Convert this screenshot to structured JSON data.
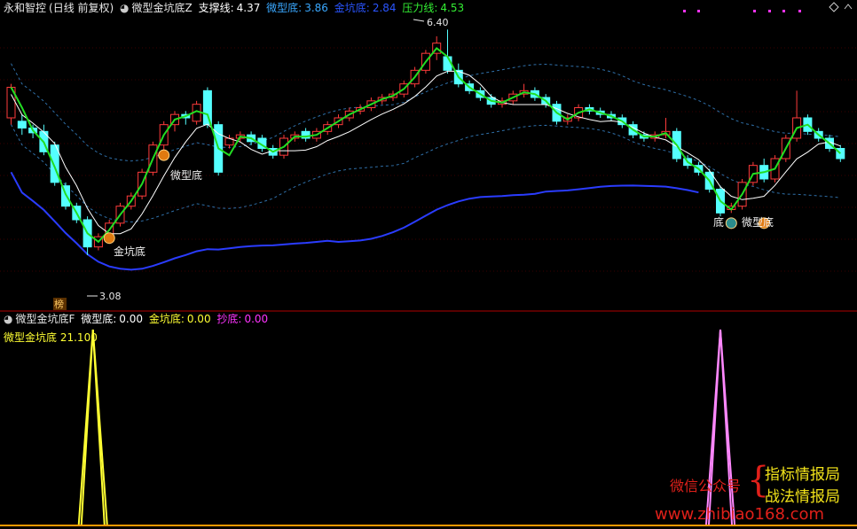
{
  "header": {
    "stock": "永和智控",
    "period": "(日线 前复权)",
    "indicator": "微型金坑底Z",
    "support_label": "支撑线:",
    "support_value": "4.37",
    "micro_label": "微型底:",
    "micro_value": "3.86",
    "pit_label": "金坑底:",
    "pit_value": "2.84",
    "pressure_label": "压力线:",
    "pressure_value": "4.53"
  },
  "lower_header": {
    "indicator": "微型金坑底F",
    "micro_label": "微型底:",
    "micro_value": "0.00",
    "pit_label": "金坑底:",
    "pit_value": "0.00",
    "bottom_label": "抄底:",
    "bottom_value": "0.00"
  },
  "lower_sub": {
    "label": "微型金坑底",
    "value": "21.100"
  },
  "annotations": {
    "high": "6.40",
    "low": "3.08",
    "micro1": "微型底",
    "pit1": "金坑底",
    "micro2": "微型底",
    "di": "底",
    "bang": "榜"
  },
  "watermark": {
    "line1": "微信公众号",
    "line2": "指标情报局",
    "line3": "战法情报局",
    "url": "www.zhibiao168.com",
    "brace": "{"
  },
  "colors": {
    "up": "#ff3b3b",
    "down": "#54ffff",
    "green_line": "#22dd22",
    "white_line": "#ffffff",
    "blue_line": "#2a3cff",
    "dash_line": "#2f6fa8",
    "yellow": "#ffff33",
    "magenta": "#ff33ff",
    "pink": "#ff88ff",
    "divider": "#b00000"
  },
  "chart_data": {
    "type": "candlestick",
    "y_range": [
      2.4,
      6.6
    ],
    "bars": [
      [
        5.1,
        5.55,
        5.0,
        5.6
      ],
      [
        5.05,
        4.95,
        4.85,
        5.15
      ],
      [
        4.95,
        4.88,
        4.8,
        5.0
      ],
      [
        4.9,
        4.6,
        4.55,
        5.0
      ],
      [
        4.7,
        4.15,
        4.1,
        4.75
      ],
      [
        4.1,
        3.8,
        3.75,
        4.15
      ],
      [
        3.8,
        3.6,
        3.55,
        3.85
      ],
      [
        3.6,
        3.2,
        3.08,
        3.65
      ],
      [
        3.2,
        3.35,
        3.15,
        3.4
      ],
      [
        3.35,
        3.55,
        3.3,
        3.6
      ],
      [
        3.55,
        3.8,
        3.5,
        3.85
      ],
      [
        3.8,
        3.95,
        3.75,
        4.0
      ],
      [
        3.95,
        4.3,
        3.9,
        4.35
      ],
      [
        4.3,
        4.7,
        4.25,
        4.75
      ],
      [
        4.7,
        5.0,
        4.6,
        5.05
      ],
      [
        5.0,
        5.15,
        4.9,
        5.2
      ],
      [
        5.15,
        5.1,
        5.0,
        5.2
      ],
      [
        5.05,
        5.3,
        5.0,
        5.35
      ],
      [
        5.5,
        5.0,
        4.95,
        5.55
      ],
      [
        5.0,
        4.3,
        4.25,
        5.05
      ],
      [
        4.7,
        4.8,
        4.65,
        4.85
      ],
      [
        4.8,
        4.85,
        4.75,
        4.9
      ],
      [
        4.85,
        4.75,
        4.7,
        4.9
      ],
      [
        4.8,
        4.65,
        4.6,
        4.85
      ],
      [
        4.65,
        4.55,
        4.5,
        4.7
      ],
      [
        4.55,
        4.8,
        4.5,
        4.85
      ],
      [
        4.8,
        4.85,
        4.75,
        4.9
      ],
      [
        4.9,
        4.8,
        4.75,
        4.95
      ],
      [
        4.8,
        4.9,
        4.75,
        4.95
      ],
      [
        4.9,
        5.0,
        4.85,
        5.05
      ],
      [
        5.0,
        5.1,
        4.95,
        5.15
      ],
      [
        5.1,
        5.2,
        5.05,
        5.25
      ],
      [
        5.2,
        5.25,
        5.15,
        5.3
      ],
      [
        5.25,
        5.35,
        5.2,
        5.4
      ],
      [
        5.35,
        5.4,
        5.3,
        5.45
      ],
      [
        5.4,
        5.45,
        5.35,
        5.5
      ],
      [
        5.45,
        5.6,
        5.4,
        5.65
      ],
      [
        5.6,
        5.8,
        5.55,
        5.85
      ],
      [
        5.8,
        6.05,
        5.75,
        6.1
      ],
      [
        6.05,
        6.2,
        5.95,
        6.3
      ],
      [
        6.0,
        5.8,
        5.75,
        6.4
      ],
      [
        5.8,
        5.6,
        5.55,
        5.9
      ],
      [
        5.6,
        5.5,
        5.45,
        5.65
      ],
      [
        5.5,
        5.4,
        5.35,
        5.55
      ],
      [
        5.4,
        5.3,
        5.25,
        5.45
      ],
      [
        5.3,
        5.35,
        5.25,
        5.4
      ],
      [
        5.35,
        5.45,
        5.3,
        5.5
      ],
      [
        5.45,
        5.5,
        5.4,
        5.6
      ],
      [
        5.5,
        5.4,
        5.35,
        5.55
      ],
      [
        5.4,
        5.3,
        5.25,
        5.45
      ],
      [
        5.3,
        5.05,
        5.0,
        5.35
      ],
      [
        5.05,
        5.1,
        5.0,
        5.15
      ],
      [
        5.1,
        5.25,
        5.05,
        5.3
      ],
      [
        5.25,
        5.2,
        5.15,
        5.3
      ],
      [
        5.2,
        5.15,
        5.1,
        5.25
      ],
      [
        5.15,
        5.1,
        5.05,
        5.2
      ],
      [
        5.1,
        5.0,
        4.95,
        5.15
      ],
      [
        5.0,
        4.85,
        4.8,
        5.05
      ],
      [
        4.85,
        4.8,
        4.75,
        4.9
      ],
      [
        4.8,
        4.85,
        4.75,
        4.9
      ],
      [
        4.85,
        4.9,
        4.8,
        5.1
      ],
      [
        4.9,
        4.5,
        4.45,
        4.95
      ],
      [
        4.5,
        4.4,
        4.35,
        4.55
      ],
      [
        4.4,
        4.3,
        4.25,
        4.45
      ],
      [
        4.3,
        4.05,
        4.0,
        4.35
      ],
      [
        4.05,
        3.7,
        3.65,
        4.1
      ],
      [
        3.75,
        3.8,
        3.7,
        3.85
      ],
      [
        3.8,
        4.15,
        3.75,
        4.2
      ],
      [
        4.15,
        4.4,
        4.1,
        4.45
      ],
      [
        4.4,
        4.2,
        4.15,
        4.5
      ],
      [
        4.2,
        4.5,
        4.15,
        4.55
      ],
      [
        4.5,
        4.8,
        4.45,
        4.85
      ],
      [
        4.8,
        5.1,
        4.75,
        5.5
      ],
      [
        5.1,
        4.9,
        4.85,
        5.15
      ],
      [
        4.9,
        4.8,
        4.75,
        4.95
      ],
      [
        4.8,
        4.65,
        4.6,
        4.85
      ],
      [
        4.65,
        4.5,
        4.45,
        4.7
      ]
    ],
    "lower_series": [
      {
        "name": "微型底",
        "color": "yellow",
        "peak_index": 4,
        "value": 21.1
      },
      {
        "name": "抄底",
        "color": "pink",
        "peak_index": 69,
        "value": 21.1
      }
    ]
  }
}
